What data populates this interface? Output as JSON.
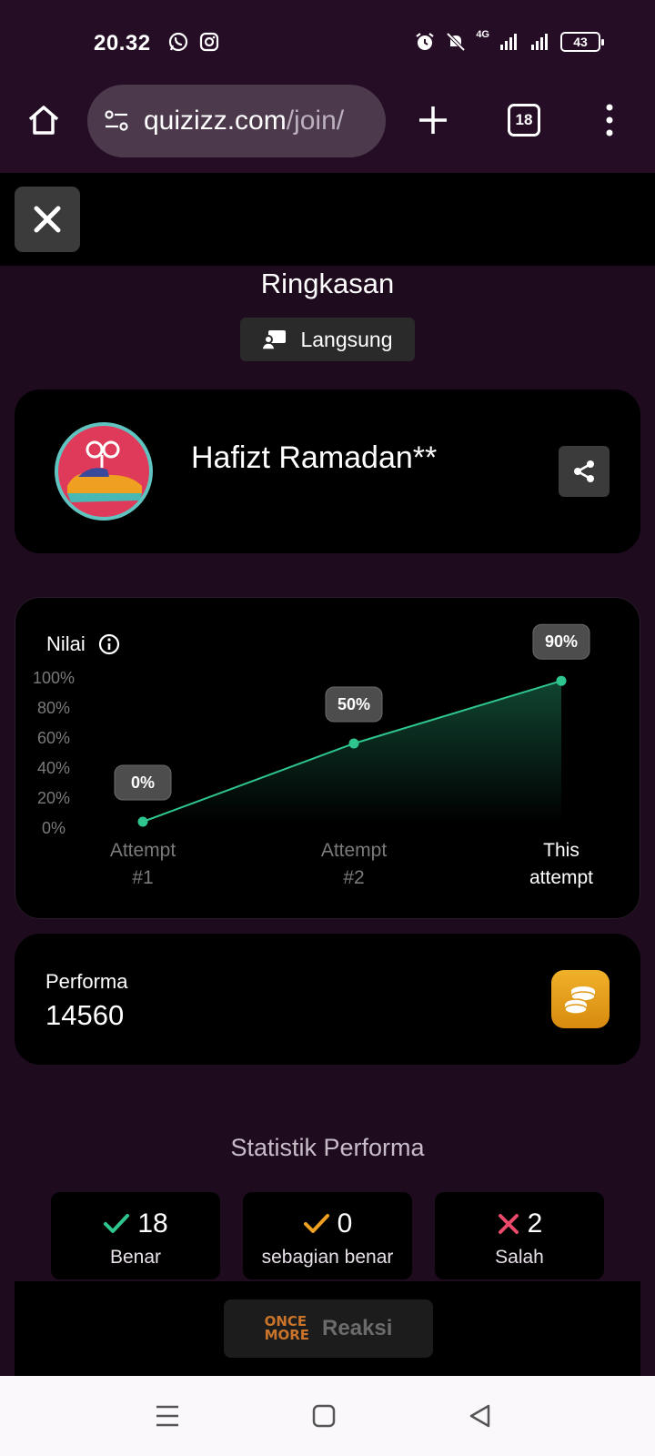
{
  "status_bar": {
    "time": "20.32",
    "network": "4G",
    "battery": "43"
  },
  "browser": {
    "url_host": "quizizz.com",
    "url_path": "/join/",
    "tab_count": "18"
  },
  "summary": {
    "title": "Ringkasan",
    "mode": "Langsung"
  },
  "player": {
    "name": "Hafizt Ramadan**"
  },
  "chart_data": {
    "type": "area",
    "title": "Nilai",
    "categories": [
      "Attempt #1",
      "Attempt #2",
      "This attempt"
    ],
    "category_lines": [
      [
        "Attempt",
        "#1"
      ],
      [
        "Attempt",
        "#2"
      ],
      [
        "This",
        "attempt"
      ]
    ],
    "values": [
      0,
      50,
      90
    ],
    "value_labels": [
      "0%",
      "50%",
      "90%"
    ],
    "y_ticks": [
      "100%",
      "80%",
      "60%",
      "40%",
      "20%",
      "0%"
    ],
    "ylim": [
      0,
      100
    ],
    "colors": {
      "line": "#2ec68e",
      "highlight": "#ffffff",
      "muted": "#7a7a7a"
    }
  },
  "performance": {
    "label": "Performa",
    "value": "14560"
  },
  "stats": {
    "title": "Statistik Performa",
    "items": [
      {
        "count": "18",
        "label": "Benar",
        "icon": "check-icon",
        "color": "#2ec68e"
      },
      {
        "count": "0",
        "label": "sebagian benar",
        "icon": "check-icon",
        "color": "#f0a020"
      },
      {
        "count": "2",
        "label": "Salah",
        "icon": "cross-icon",
        "color": "#ec4a6b"
      }
    ]
  },
  "reaction": {
    "badge_line1": "ONCE",
    "badge_line2": "MORE",
    "label": "Reaksi"
  }
}
